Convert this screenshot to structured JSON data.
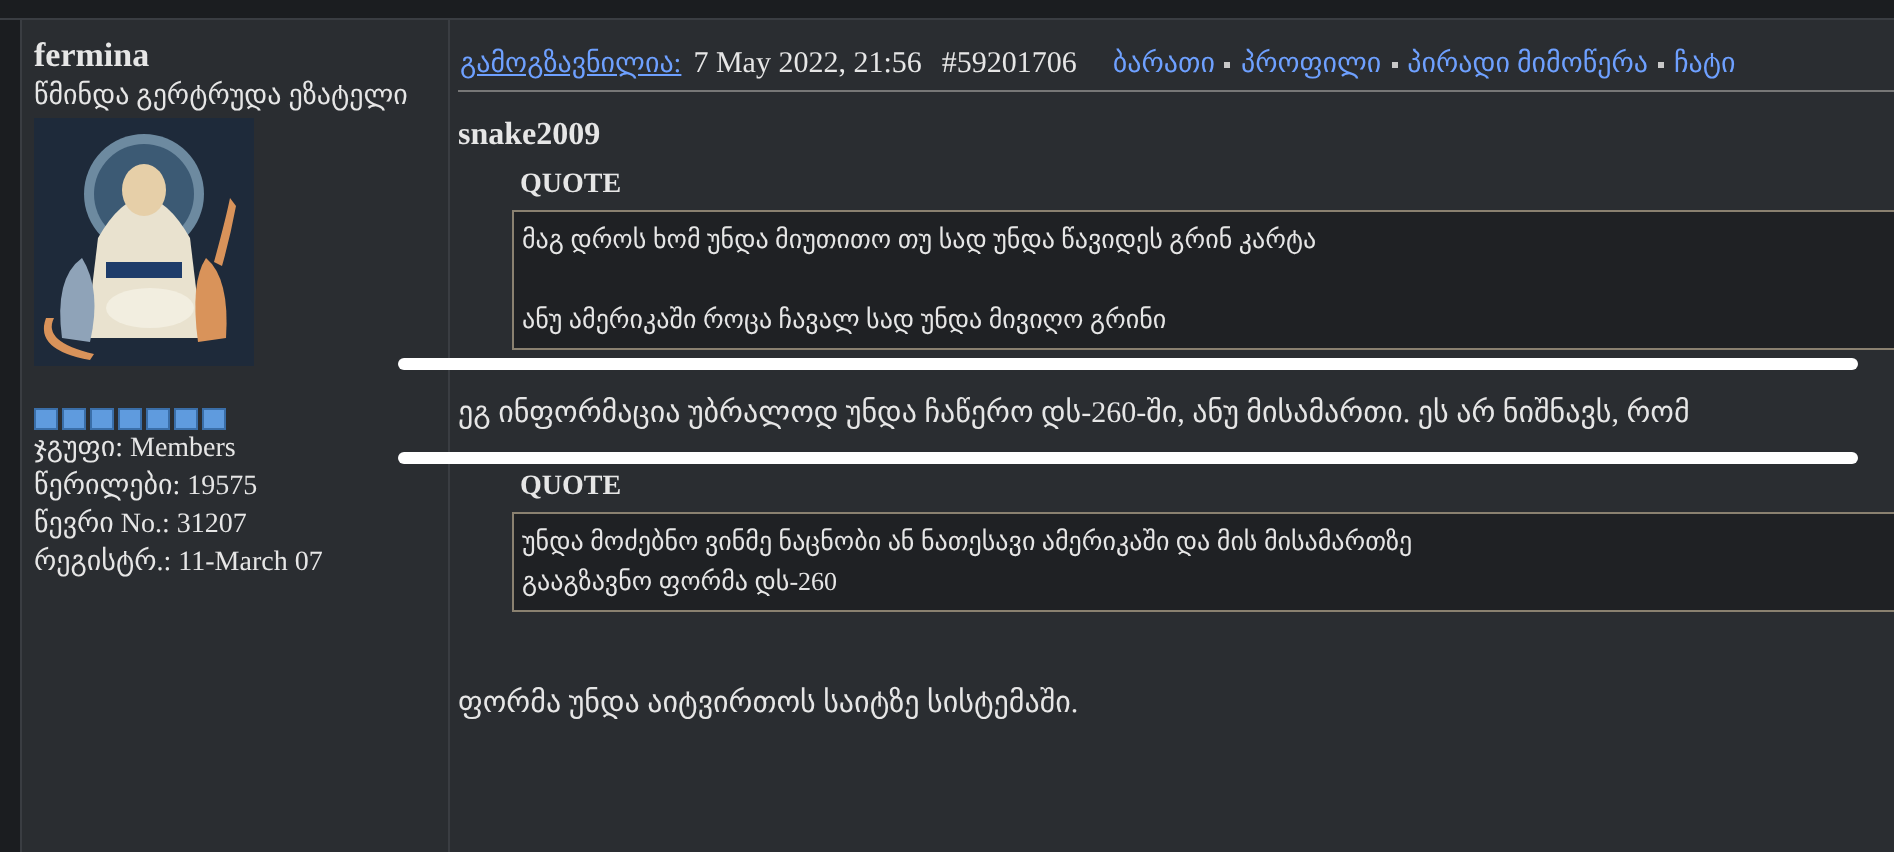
{
  "author": {
    "name": "fermina",
    "title": "წმინდა გერტრუდა ეზატელი",
    "rank": {
      "stars": 7
    },
    "stats": [
      {
        "label": "ჯგუფი:",
        "value": "Members"
      },
      {
        "label": "წერილები:",
        "value": "19575"
      },
      {
        "label": "წევრი No.:",
        "value": "31207"
      },
      {
        "label": "რეგისტრ.:",
        "value": "11-March 07"
      }
    ]
  },
  "post": {
    "posted_label": "გამოგზავნილია:",
    "date": "7 May 2022, 21:56",
    "number": "#59201706",
    "links": [
      {
        "label": "ბარათი"
      },
      {
        "label": "პროფილი"
      },
      {
        "label": "პირადი მიმოწერა"
      },
      {
        "label": "ჩატი"
      }
    ],
    "body": [
      {
        "kind": "author",
        "text": "snake2009"
      },
      {
        "kind": "quote",
        "label": "QUOTE",
        "paragraphs": [
          [
            "მაგ დროს ხომ უნდა მიუთითო თუ სად უნდა წავიდეს გრინ კარტა"
          ],
          [
            "ანუ ამერიკაში როცა ჩავალ სად უნდა მივიღო გრინი"
          ]
        ]
      },
      {
        "kind": "mark"
      },
      {
        "kind": "text",
        "text": "ეგ ინფორმაცია უბრალოდ უნდა ჩაწერო დს-260-ში, ანუ მისამართი. ეს არ ნიშნავს, რომ"
      },
      {
        "kind": "mark"
      },
      {
        "kind": "quote",
        "label": "QUOTE",
        "paragraphs": [
          [
            "უნდა მოძებნო ვინმე ნაცნობი ან ნათესავი ამერიკაში და მის მისამართზე",
            "გააგზავნო ფორმა დს-260"
          ]
        ]
      },
      {
        "kind": "text",
        "text": "ფორმა უნდა აიტვირთოს საიტზე სისტემაში."
      }
    ]
  }
}
